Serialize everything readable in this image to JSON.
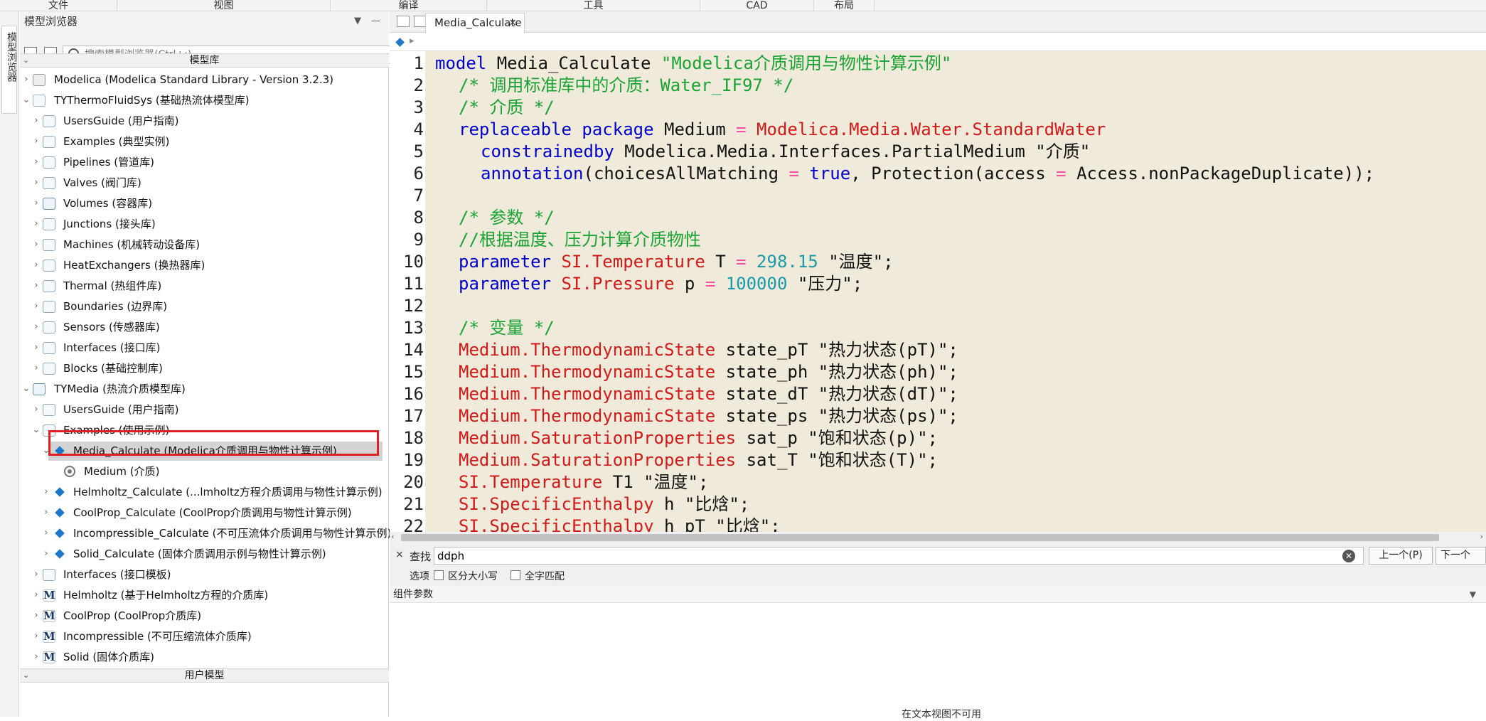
{
  "menu": [
    "文件",
    "视图",
    "编译",
    "工具",
    "CAD",
    "布局"
  ],
  "side_strip": {
    "tab_label": "模型浏览器"
  },
  "browser": {
    "title": "模型浏览器",
    "pin": "▼",
    "minimize": "—",
    "search_placeholder": "搜索模型浏览器(Ctrl+;)",
    "library_header": "模型库",
    "user_header": "用户模型",
    "items": [
      "Modelica (Modelica Standard Library - Version 3.2.3)",
      "TYThermoFluidSys (基础热流体模型库)",
      "UsersGuide (用户指南)",
      "Examples (典型实例)",
      "Pipelines (管道库)",
      "Valves (阀门库)",
      "Volumes (容器库)",
      "Junctions (接头库)",
      "Machines (机械转动设备库)",
      "HeatExchangers (换热器库)",
      "Thermal (热组件库)",
      "Boundaries (边界库)",
      "Sensors (传感器库)",
      "Interfaces (接口库)",
      "Blocks (基础控制库)",
      "TYMedia (热流介质模型库)",
      "UsersGuide (用户指南)",
      "Examples (使用示例)",
      "Media_Calculate (Modelica介质调用与物性计算示例)",
      "Medium (介质)",
      "Helmholtz_Calculate (...lmholtz方程介质调用与物性计算示例)",
      "CoolProp_Calculate (CoolProp介质调用与物性计算示例)",
      "Incompressible_Calculate (不可压流体介质调用与物性计算示例)",
      "Solid_Calculate (固体介质调用示例与物性计算示例)",
      "Interfaces (接口模板)",
      "Helmholtz (基于Helmholtz方程的介质库)",
      "CoolProp (CoolProp介质库)",
      "Incompressible (不可压缩流体介质库)",
      "Solid (固体介质库)"
    ]
  },
  "editor": {
    "tab_title": "Media_Calculate",
    "tab_close": "×",
    "breadcrumb_sep": "▸",
    "line_numbers": [
      "1",
      "2",
      "3",
      "4",
      "5",
      "6",
      "7",
      "8",
      "9",
      "10",
      "11",
      "12",
      "13",
      "14",
      "15",
      "16",
      "17",
      "18",
      "19",
      "20",
      "21",
      "22"
    ],
    "code": {
      "l1": {
        "kw": "model",
        "name": " Media_Calculate ",
        "str": "\"Modelica介质调用与物性计算示例\""
      },
      "l2": "/* 调用标准库中的介质：Water_IF97 */",
      "l3": "/* 介质 */",
      "l4": {
        "kw1": "replaceable",
        "kw2": "package",
        "name": " Medium ",
        "op": "=",
        "ty": " Modelica.Media.Water.StandardWater"
      },
      "l5": {
        "kw": "constrainedby",
        "name": " Modelica.Media.Interfaces.PartialMedium ",
        "str": "\"介质\""
      },
      "l6": {
        "kw": "annotation",
        "p1": "(choicesAllMatching ",
        "op1": "=",
        "kw2": " true",
        "p2": ", Protection(access ",
        "op2": "=",
        "p3": " Access.nonPackageDuplicate));"
      },
      "l8": "/* 参数 */",
      "l9": "//根据温度、压力计算介质物性",
      "l10": {
        "kw": "parameter",
        "ty": " SI.Temperature",
        "name": " T ",
        "op": "=",
        "num": " 298.15",
        "str": " \"温度\";"
      },
      "l11": {
        "kw": "parameter",
        "ty": " SI.Pressure",
        "name": " p ",
        "op": "=",
        "num": " 100000",
        "str": " \"压力\";"
      },
      "l13": "/* 变量 */",
      "l14": {
        "ty": "Medium.ThermodynamicState",
        "rest": " state_pT \"热力状态(pT)\";"
      },
      "l15": {
        "ty": "Medium.ThermodynamicState",
        "rest": " state_ph \"热力状态(ph)\";"
      },
      "l16": {
        "ty": "Medium.ThermodynamicState",
        "rest": " state_dT \"热力状态(dT)\";"
      },
      "l17": {
        "ty": "Medium.ThermodynamicState",
        "rest": " state_ps \"热力状态(ps)\";"
      },
      "l18": {
        "ty": "Medium.SaturationProperties",
        "rest": " sat_p \"饱和状态(p)\";"
      },
      "l19": {
        "ty": "Medium.SaturationProperties",
        "rest": " sat_T \"饱和状态(T)\";"
      },
      "l20": {
        "ty": "SI.Temperature",
        "rest": " T1 \"温度\";"
      },
      "l21": {
        "ty": "SI.SpecificEnthalpy",
        "rest": " h \"比焓\";"
      },
      "l22": {
        "ty": "SI.SpecificEnthalpy",
        "rest": " h_pT \"比焓\";"
      }
    }
  },
  "find": {
    "close": "×",
    "label": "查找",
    "value": "ddph",
    "prev_button": "上一个(P)",
    "next_button": "下一个(N)",
    "options_label": "选项",
    "case_label": "区分大小写",
    "whole_word_label": "全字匹配"
  },
  "params": {
    "title": "组件参数",
    "note": "在文本视图不可用"
  },
  "colors": {
    "keyword": "#0000cc",
    "type": "#d11a1a",
    "comment": "#1aa334",
    "number": "#1a9aa8",
    "operator": "#ff4da6",
    "code_bg": "#efead9",
    "selection_frame": "#e02020"
  }
}
